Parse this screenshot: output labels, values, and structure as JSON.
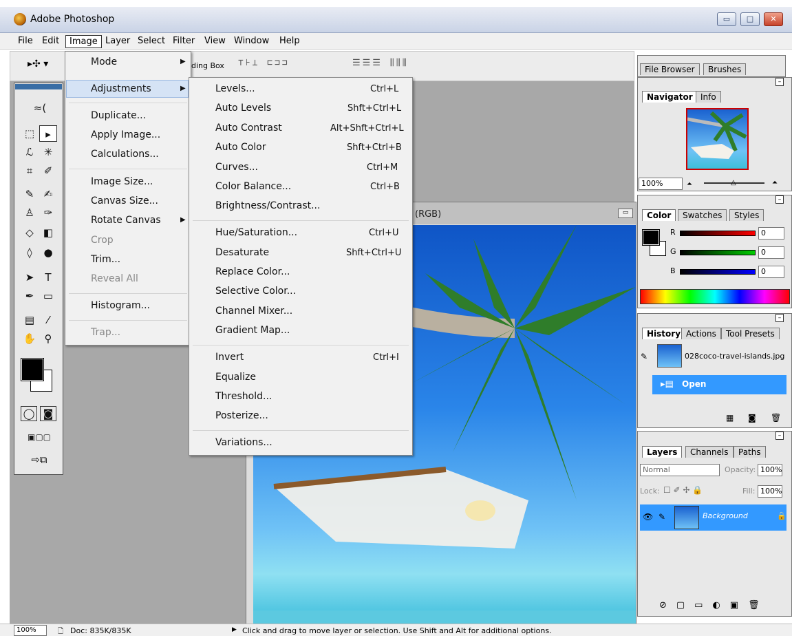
{
  "window": {
    "title": "Adobe Photoshop",
    "min_label": "▭",
    "max_label": "□",
    "close_label": "✕"
  },
  "menubar": [
    "File",
    "Edit",
    "Image",
    "Layer",
    "Select",
    "Filter",
    "View",
    "Window",
    "Help"
  ],
  "options_bar": {
    "bounding_box_label": "ding Box"
  },
  "image_menu": {
    "items": [
      "Mode",
      "Adjustments",
      "Duplicate...",
      "Apply Image...",
      "Calculations...",
      "Image Size...",
      "Canvas Size...",
      "Rotate Canvas",
      "Crop",
      "Trim...",
      "Reveal All",
      "Histogram...",
      "Trap..."
    ],
    "disabled": [
      "Crop",
      "Reveal All",
      "Trap..."
    ],
    "submenu_arrows": [
      "Mode",
      "Adjustments",
      "Rotate Canvas"
    ],
    "highlighted": "Adjustments"
  },
  "adjustments_menu": {
    "items": [
      {
        "label": "Levels...",
        "shortcut": "Ctrl+L"
      },
      {
        "label": "Auto Levels",
        "shortcut": "Shft+Ctrl+L"
      },
      {
        "label": "Auto Contrast",
        "shortcut": "Alt+Shft+Ctrl+L"
      },
      {
        "label": "Auto Color",
        "shortcut": "Shft+Ctrl+B"
      },
      {
        "label": "Curves...",
        "shortcut": "Ctrl+M"
      },
      {
        "label": "Color Balance...",
        "shortcut": "Ctrl+B"
      },
      {
        "label": "Brightness/Contrast...",
        "shortcut": ""
      },
      {
        "label": "Hue/Saturation...",
        "shortcut": "Ctrl+U"
      },
      {
        "label": "Desaturate",
        "shortcut": "Shft+Ctrl+U"
      },
      {
        "label": "Replace Color...",
        "shortcut": ""
      },
      {
        "label": "Selective Color...",
        "shortcut": ""
      },
      {
        "label": "Channel Mixer...",
        "shortcut": ""
      },
      {
        "label": "Gradient Map...",
        "shortcut": ""
      },
      {
        "label": "Invert",
        "shortcut": "Ctrl+I"
      },
      {
        "label": "Equalize",
        "shortcut": ""
      },
      {
        "label": "Threshold...",
        "shortcut": ""
      },
      {
        "label": "Posterize...",
        "shortcut": ""
      },
      {
        "label": "Variations...",
        "shortcut": ""
      }
    ]
  },
  "document": {
    "title_suffix": "(RGB)"
  },
  "palette_well": {
    "tabs": [
      "File Browser",
      "Brushes"
    ]
  },
  "navigator": {
    "tabs": [
      "Navigator",
      "Info"
    ],
    "zoom": "100%"
  },
  "color_panel": {
    "tabs": [
      "Color",
      "Swatches",
      "Styles"
    ],
    "channels": [
      {
        "label": "R",
        "value": "0"
      },
      {
        "label": "G",
        "value": "0"
      },
      {
        "label": "B",
        "value": "0"
      }
    ]
  },
  "history_panel": {
    "tabs": [
      "History",
      "Actions",
      "Tool Presets"
    ],
    "snapshot": "028coco-travel-islands.jpg",
    "states": [
      "Open"
    ]
  },
  "layers_panel": {
    "tabs": [
      "Layers",
      "Channels",
      "Paths"
    ],
    "blend_mode": "Normal",
    "opacity_label": "Opacity:",
    "opacity": "100%",
    "lock_label": "Lock:",
    "fill_label": "Fill:",
    "fill": "100%",
    "layers": [
      "Background"
    ]
  },
  "status_bar": {
    "zoom": "100%",
    "doc": "Doc: 835K/835K",
    "hint": "Click and drag to move layer or selection.  Use Shift and Alt for additional options."
  },
  "colors": {
    "accent": "#3a6ea5",
    "selection": "#3399ff",
    "close_red": "#c6422a"
  }
}
